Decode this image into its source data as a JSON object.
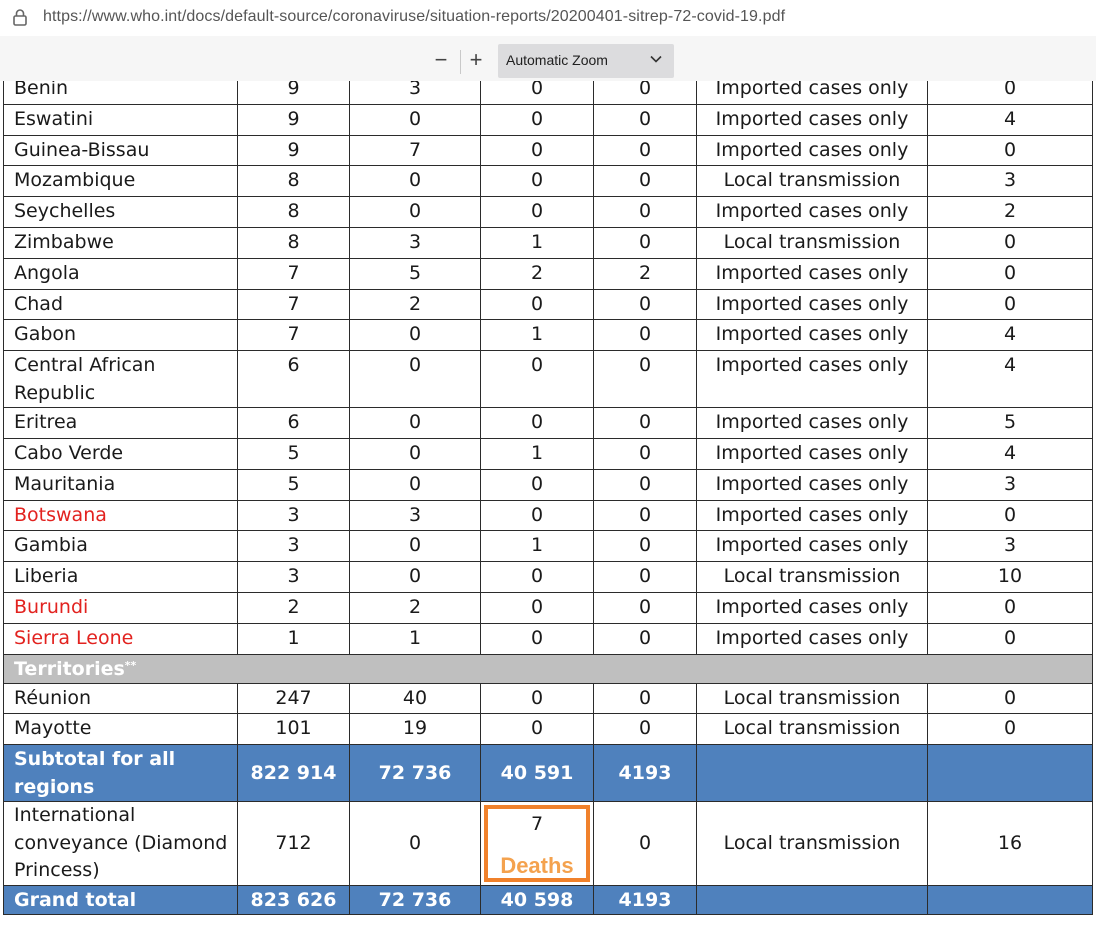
{
  "browser": {
    "url": "https://www.who.int/docs/default-source/coronaviruse/situation-reports/20200401-sitrep-72-covid-19.pdf",
    "icon": "lock-icon"
  },
  "toolbar": {
    "zoom_out": "−",
    "zoom_in": "+",
    "zoom_level": "Automatic Zoom"
  },
  "table": {
    "rows": [
      {
        "name": "Benin",
        "c1": "9",
        "c2": "3",
        "c3": "0",
        "c4": "0",
        "mode": "Imported cases only",
        "days": "0"
      },
      {
        "name": "Eswatini",
        "c1": "9",
        "c2": "0",
        "c3": "0",
        "c4": "0",
        "mode": "Imported cases only",
        "days": "4"
      },
      {
        "name": "Guinea-Bissau",
        "c1": "9",
        "c2": "7",
        "c3": "0",
        "c4": "0",
        "mode": "Imported cases only",
        "days": "0"
      },
      {
        "name": "Mozambique",
        "c1": "8",
        "c2": "0",
        "c3": "0",
        "c4": "0",
        "mode": "Local transmission",
        "days": "3"
      },
      {
        "name": "Seychelles",
        "c1": "8",
        "c2": "0",
        "c3": "0",
        "c4": "0",
        "mode": "Imported cases only",
        "days": "2"
      },
      {
        "name": "Zimbabwe",
        "c1": "8",
        "c2": "3",
        "c3": "1",
        "c4": "0",
        "mode": "Local transmission",
        "days": "0"
      },
      {
        "name": "Angola",
        "c1": "7",
        "c2": "5",
        "c3": "2",
        "c4": "2",
        "mode": "Imported cases only",
        "days": "0"
      },
      {
        "name": "Chad",
        "c1": "7",
        "c2": "2",
        "c3": "0",
        "c4": "0",
        "mode": "Imported cases only",
        "days": "0"
      },
      {
        "name": "Gabon",
        "c1": "7",
        "c2": "0",
        "c3": "1",
        "c4": "0",
        "mode": "Imported cases only",
        "days": "4"
      },
      {
        "name": "Central African Republic",
        "c1": "6",
        "c2": "0",
        "c3": "0",
        "c4": "0",
        "mode": "Imported cases only",
        "days": "4"
      },
      {
        "name": "Eritrea",
        "c1": "6",
        "c2": "0",
        "c3": "0",
        "c4": "0",
        "mode": "Imported cases only",
        "days": "5"
      },
      {
        "name": "Cabo Verde",
        "c1": "5",
        "c2": "0",
        "c3": "1",
        "c4": "0",
        "mode": "Imported cases only",
        "days": "4"
      },
      {
        "name": "Mauritania",
        "c1": "5",
        "c2": "0",
        "c3": "0",
        "c4": "0",
        "mode": "Imported cases only",
        "days": "3"
      },
      {
        "name": "Botswana",
        "c1": "3",
        "c2": "3",
        "c3": "0",
        "c4": "0",
        "mode": "Imported cases only",
        "days": "0"
      },
      {
        "name": "Gambia",
        "c1": "3",
        "c2": "0",
        "c3": "1",
        "c4": "0",
        "mode": "Imported cases only",
        "days": "3"
      },
      {
        "name": "Liberia",
        "c1": "3",
        "c2": "0",
        "c3": "0",
        "c4": "0",
        "mode": "Local transmission",
        "days": "10"
      },
      {
        "name": "Burundi",
        "c1": "2",
        "c2": "2",
        "c3": "0",
        "c4": "0",
        "mode": "Imported cases only",
        "days": "0"
      },
      {
        "name": "Sierra Leone",
        "c1": "1",
        "c2": "1",
        "c3": "0",
        "c4": "0",
        "mode": "Imported cases only",
        "days": "0"
      }
    ],
    "section_title": "Territories",
    "section_mark": "**",
    "territories": [
      {
        "name": "Réunion",
        "c1": "247",
        "c2": "40",
        "c3": "0",
        "c4": "0",
        "mode": "Local transmission",
        "days": "0"
      },
      {
        "name": "Mayotte",
        "c1": "101",
        "c2": "19",
        "c3": "0",
        "c4": "0",
        "mode": "Local transmission",
        "days": "0"
      }
    ],
    "subtotal": {
      "name": "Subtotal for all regions",
      "c1": "822 914",
      "c2": "72 736",
      "c3": "40 591",
      "c4": "4193"
    },
    "conveyance": {
      "name": "International conveyance (Diamond Princess)",
      "c1": "712",
      "c2": "0",
      "c3": "7",
      "c4": "0",
      "mode": "Local transmission",
      "days": "16"
    },
    "annotation": {
      "label": "Deaths",
      "color": "#f0812b"
    },
    "grand_total": {
      "name": "Grand total",
      "c1": "823 626",
      "c2": "72 736",
      "c3": "40 598",
      "c4": "4193"
    },
    "highlight_color": "#e2221f",
    "section_bg": "#bfbfbf",
    "total_bg": "#4f81bd"
  }
}
